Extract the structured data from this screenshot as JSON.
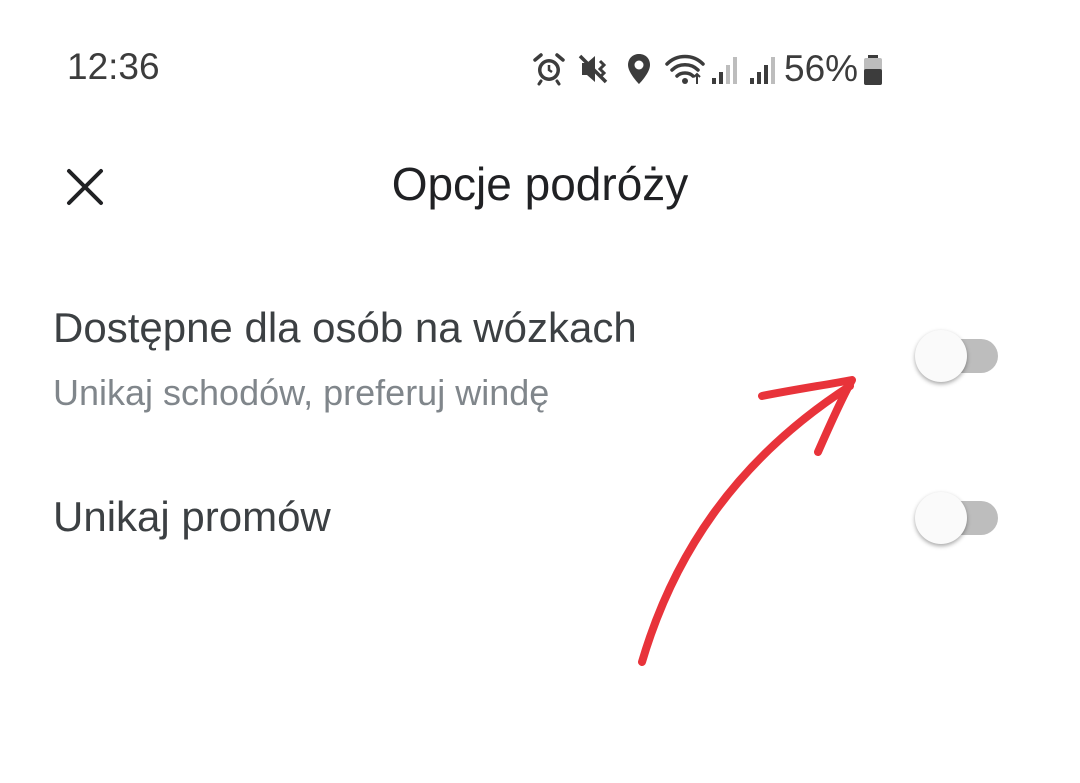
{
  "status_bar": {
    "time": "12:36",
    "battery": "56%",
    "icons": [
      "alarm-icon",
      "vibrate-icon",
      "location-icon",
      "wifi-icon",
      "signal-icon",
      "signal-icon",
      "battery-icon"
    ]
  },
  "header": {
    "close_icon": "close-icon",
    "title": "Opcje podróży"
  },
  "settings": [
    {
      "label": "Dostępne dla osób na wózkach",
      "sublabel": "Unikaj schodów, preferuj windę",
      "enabled": false
    },
    {
      "label": "Unikaj promów",
      "enabled": false
    }
  ],
  "colors": {
    "text_primary": "#202124",
    "text_secondary": "#80868b",
    "toggle_track_off": "#bdbdbd",
    "toggle_thumb_off": "#fafafa",
    "annotation_arrow": "#e8333a"
  }
}
